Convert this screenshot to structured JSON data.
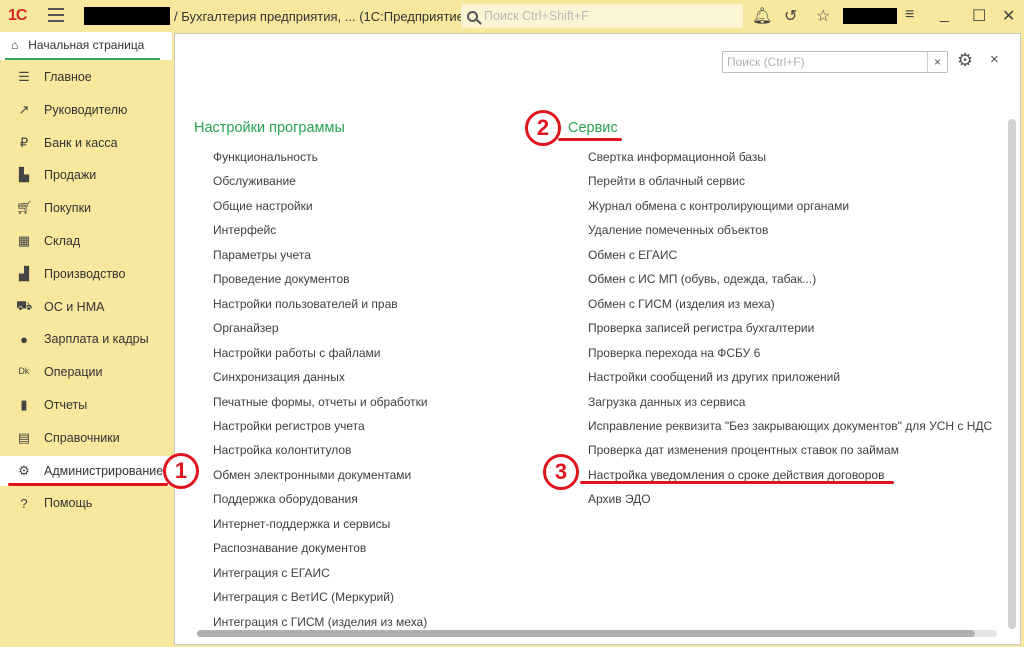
{
  "titlebar": {
    "logo": "1С",
    "title": "/ Бухгалтерия предприятия, ...   (1С:Предприятие)",
    "search_placeholder": "Поиск Ctrl+Shift+F"
  },
  "tabs": [
    {
      "label": "Начальная страница"
    }
  ],
  "sidebar": {
    "items": [
      {
        "label": "Главное",
        "icon": "menu-icon"
      },
      {
        "label": "Руководителю",
        "icon": "trend-icon"
      },
      {
        "label": "Банк и касса",
        "icon": "ruble-icon"
      },
      {
        "label": "Продажи",
        "icon": "bag-icon"
      },
      {
        "label": "Покупки",
        "icon": "cart-icon"
      },
      {
        "label": "Склад",
        "icon": "warehouse-icon"
      },
      {
        "label": "Производство",
        "icon": "factory-icon"
      },
      {
        "label": "ОС и НМА",
        "icon": "truck-icon"
      },
      {
        "label": "Зарплата и кадры",
        "icon": "person-icon"
      },
      {
        "label": "Операции",
        "icon": "dt-kt-icon"
      },
      {
        "label": "Отчеты",
        "icon": "bar-chart-icon"
      },
      {
        "label": "Справочники",
        "icon": "books-icon"
      },
      {
        "label": "Администрирование",
        "icon": "gear-icon",
        "active": true
      },
      {
        "label": "Помощь",
        "icon": "help-icon"
      }
    ]
  },
  "panel": {
    "search_placeholder": "Поиск (Ctrl+F)",
    "clear": "×",
    "close": "×"
  },
  "left_section": {
    "title": "Настройки программы",
    "links": [
      "Функциональность",
      "Обслуживание",
      "Общие настройки",
      "Интерфейс",
      "Параметры учета",
      "Проведение документов",
      "Настройки пользователей и прав",
      "Органайзер",
      "Настройки работы с файлами",
      "Синхронизация данных",
      "Печатные формы, отчеты и обработки",
      "Настройки регистров учета",
      "Настройка колонтитулов",
      "Обмен электронными документами",
      "Поддержка оборудования",
      "Интернет-поддержка и сервисы",
      "Распознавание документов",
      "Интеграция с ЕГАИС",
      "Интеграция с ВетИС (Меркурий)",
      "Интеграция с ГИСМ (изделия из меха)"
    ]
  },
  "right_section": {
    "title": "Сервис",
    "links": [
      "Свертка информационной базы",
      "Перейти в облачный сервис",
      "Журнал обмена с контролирующими органами",
      "Удаление помеченных объектов",
      "Обмен с ЕГАИС",
      "Обмен с ИС МП (обувь, одежда, табак...)",
      "Обмен с ГИСМ (изделия из меха)",
      "Проверка записей регистра бухгалтерии",
      "Проверка перехода на ФСБУ 6",
      "Настройки сообщений из других приложений",
      "Загрузка данных из сервиса",
      "Исправление реквизита \"Без закрывающих документов\" для УСН с НДС",
      "Проверка дат изменения процентных ставок по займам",
      "Настройка уведомления о сроке действия договоров",
      "Архив ЭДО"
    ]
  },
  "annotations": [
    "1",
    "2",
    "3"
  ],
  "colors": {
    "accent": "#27a24f",
    "titlebar": "#f7e89d",
    "annotation": "#e0141e"
  }
}
